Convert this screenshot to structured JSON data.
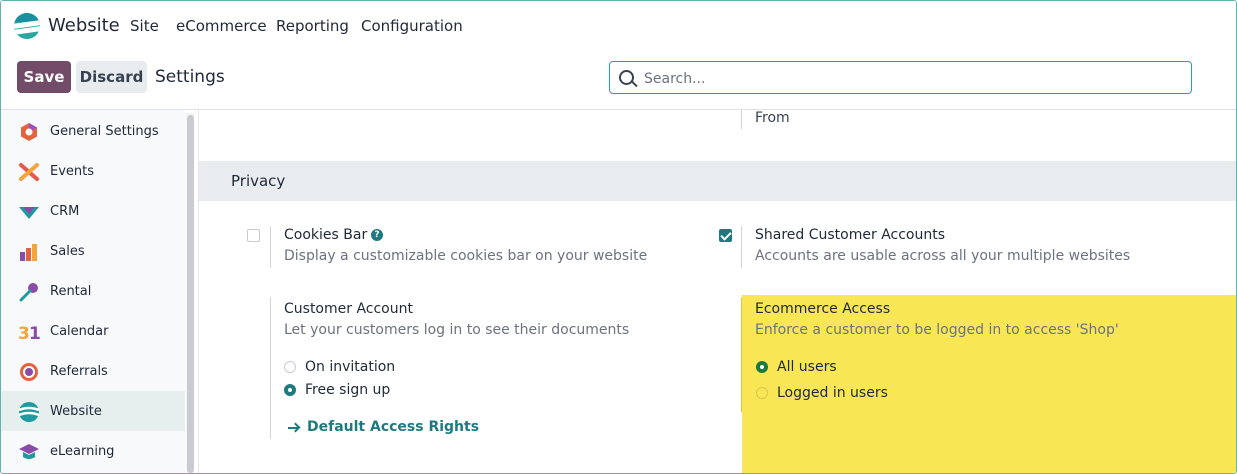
{
  "app": {
    "name": "Website"
  },
  "menu": [
    "Site",
    "eCommerce",
    "Reporting",
    "Configuration"
  ],
  "control": {
    "save": "Save",
    "discard": "Discard",
    "title": "Settings",
    "search_placeholder": "Search..."
  },
  "sidebar": {
    "items": [
      {
        "label": "General Settings",
        "icon": "general-settings-icon"
      },
      {
        "label": "Events",
        "icon": "events-icon"
      },
      {
        "label": "CRM",
        "icon": "crm-icon"
      },
      {
        "label": "Sales",
        "icon": "sales-icon"
      },
      {
        "label": "Rental",
        "icon": "rental-icon"
      },
      {
        "label": "Calendar",
        "icon": "calendar-icon"
      },
      {
        "label": "Referrals",
        "icon": "referrals-icon"
      },
      {
        "label": "Website",
        "icon": "website-icon",
        "active": true
      },
      {
        "label": "eLearning",
        "icon": "elearning-icon"
      }
    ]
  },
  "content": {
    "from_label": "From",
    "section": "Privacy",
    "cookies": {
      "title": "Cookies Bar",
      "desc": "Display a customizable cookies bar on your website",
      "checked": false
    },
    "shared": {
      "title": "Shared Customer Accounts",
      "desc": "Accounts are usable across all your multiple websites",
      "checked": true
    },
    "customer_account": {
      "title": "Customer Account",
      "desc": "Let your customers log in to see their documents",
      "options": [
        "On invitation",
        "Free sign up"
      ],
      "selected": "Free sign up",
      "link": "Default Access Rights"
    },
    "ecommerce_access": {
      "title": "Ecommerce Access",
      "desc": "Enforce a customer to be logged in to access 'Shop'",
      "options": [
        "All users",
        "Logged in users"
      ],
      "selected": "All users"
    }
  },
  "colors": {
    "brand": "#714b67",
    "accent": "#1f7a80",
    "highlight": "#f9e654"
  }
}
